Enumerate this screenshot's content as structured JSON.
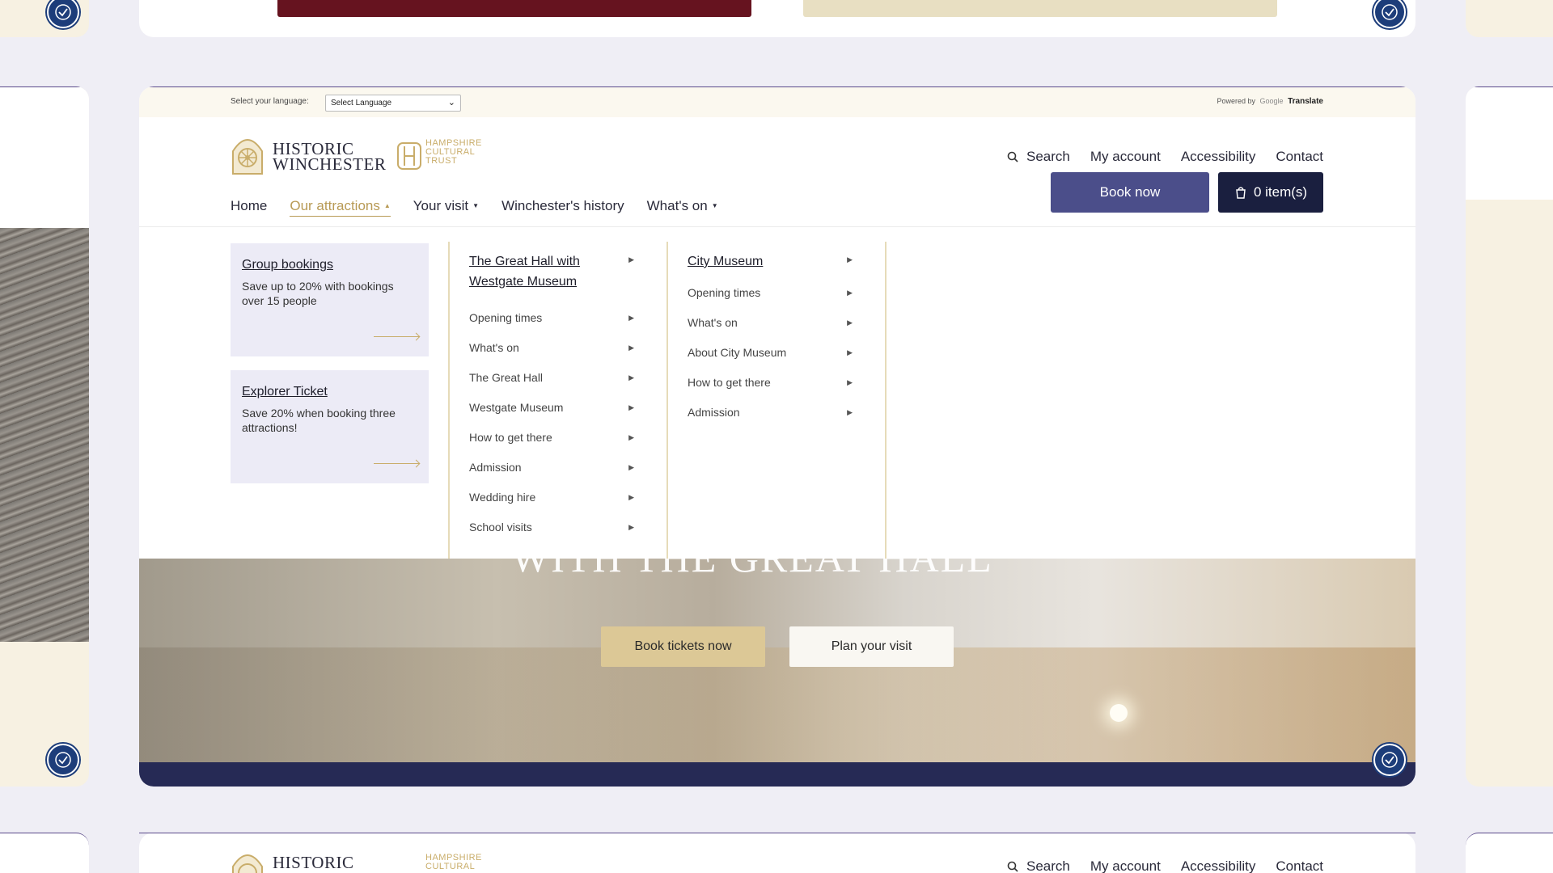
{
  "language_bar": {
    "label": "Select your language:",
    "select_value": "Select Language",
    "powered_by": "Powered by",
    "google": "Google",
    "translate": "Translate"
  },
  "brand": {
    "logo_line1": "HISTORIC",
    "logo_line2": "WINCHESTER",
    "partner_line1": "HAMPSHIRE",
    "partner_line2": "CULTURAL",
    "partner_line3": "TRUST"
  },
  "utility_nav": {
    "search": "Search",
    "account": "My account",
    "accessibility": "Accessibility",
    "contact": "Contact"
  },
  "actions": {
    "book_now": "Book now",
    "cart": "0 item(s)"
  },
  "main_nav": {
    "home": "Home",
    "attractions": "Our attractions",
    "visit": "Your visit",
    "history": "Winchester's history",
    "whats_on": "What's on"
  },
  "promos": [
    {
      "title": "Group bookings",
      "desc": "Save up to 20% with bookings over 15 people"
    },
    {
      "title": "Explorer Ticket",
      "desc": "Save 20% when booking three attractions!"
    }
  ],
  "columns": [
    {
      "heading": "The Great Hall with Westgate Museum",
      "items": [
        "Opening times",
        "What's on",
        "The Great Hall",
        "Westgate Museum",
        "How to get there",
        "Admission",
        "Wedding hire",
        "School visits"
      ]
    },
    {
      "heading": "City Museum",
      "items": [
        "Opening times",
        "What's on",
        "About City Museum",
        "How to get there",
        "Admission"
      ]
    }
  ],
  "hero": {
    "heading": "WITH THE GREAT HALL",
    "primary_button": "Book tickets now",
    "secondary_button": "Plan your visit"
  },
  "colors": {
    "accent_gold": "#b89a55",
    "book_button": "#4b4e8a",
    "cart_button": "#1a1f3f",
    "promo_bg": "#ecebf6",
    "badge": "#1d3d7a"
  }
}
